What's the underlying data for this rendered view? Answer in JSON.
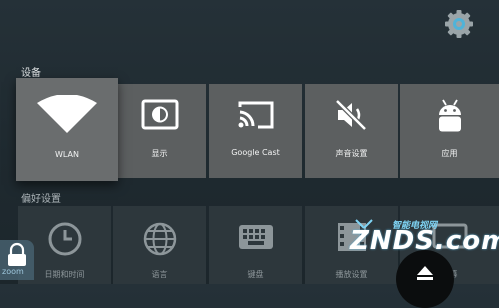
{
  "sections": {
    "devices_title": "设备",
    "preferences_title": "偏好设置"
  },
  "device_tiles": [
    {
      "label": "WLAN",
      "icon": "wifi-icon",
      "focused": true
    },
    {
      "label": "显示",
      "icon": "display-brightness-icon"
    },
    {
      "label": "Google Cast",
      "icon": "cast-icon"
    },
    {
      "label": "声音设置",
      "icon": "sound-muted-icon"
    },
    {
      "label": "应用",
      "icon": "android-icon"
    }
  ],
  "preference_tiles": [
    {
      "label": "日期和时间",
      "icon": "clock-icon"
    },
    {
      "label": "语言",
      "icon": "globe-icon"
    },
    {
      "label": "键盘",
      "icon": "keyboard-icon"
    },
    {
      "label": "播放设置",
      "icon": "film-icon"
    },
    {
      "label": "屏幕",
      "icon": "screen-icon"
    }
  ],
  "overlays": {
    "zoom_label": "zoom",
    "watermark_small": "智能电视网",
    "watermark_big": "ZNDS.com"
  },
  "colors": {
    "tile": "#5c5f60",
    "tile_focused": "#6a6d6e",
    "background": "#253138",
    "gear": "#4fb3d9"
  }
}
